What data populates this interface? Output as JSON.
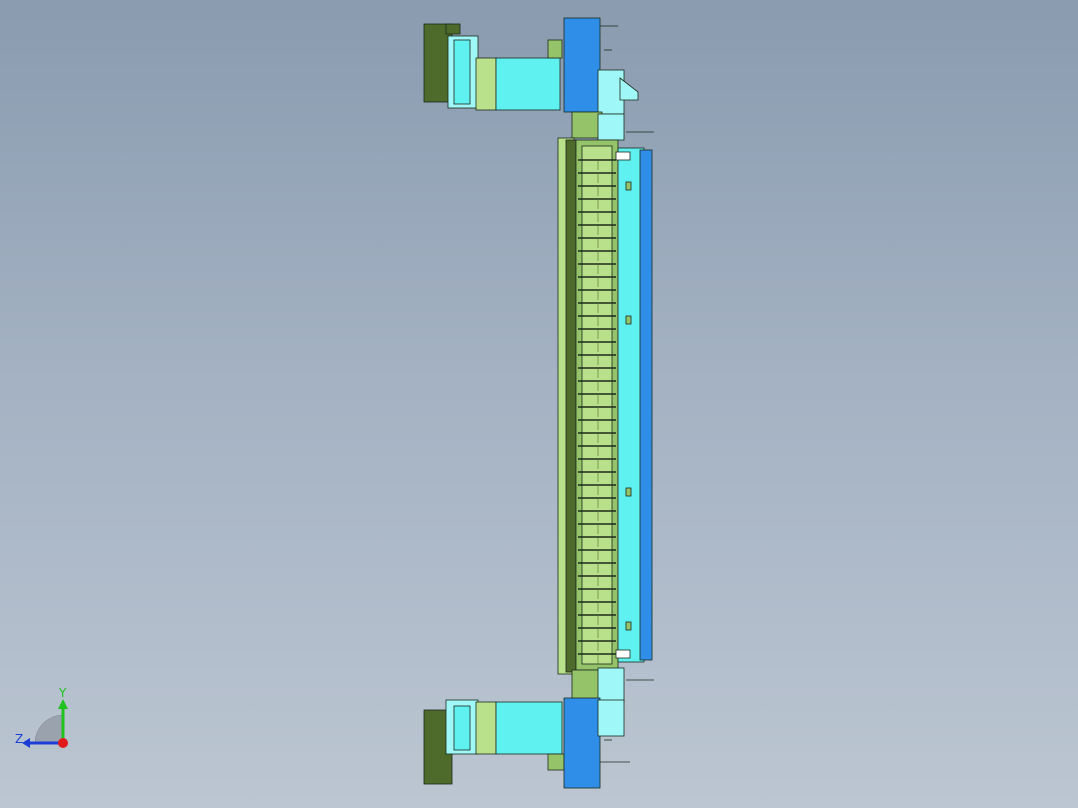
{
  "colors": {
    "background_top": "#8a9bb0",
    "background_bottom": "#bcc6d2",
    "dark_green": "#4f6b2b",
    "light_green": "#b9e08a",
    "mid_green": "#94c36a",
    "cyan": "#5ff0f0",
    "light_cyan": "#9ff7f7",
    "blue": "#2f8fe8",
    "pale_blue": "#bfe9ff",
    "outline": "#1b2a1b"
  },
  "triad": {
    "y_label": "Y",
    "z_label": "Z",
    "y_color": "#1fc21f",
    "z_color": "#1b3fd6",
    "x_color": "#e11b1b"
  }
}
